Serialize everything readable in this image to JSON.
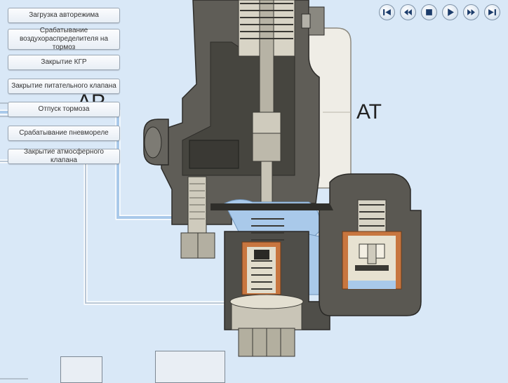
{
  "menu": {
    "items": [
      {
        "label": "Загрузка авторежима"
      },
      {
        "label": "Срабатывание воздухораспределителя на тормоз"
      },
      {
        "label": "Закрытие КГР"
      },
      {
        "label": "Закрытие питательного клапана"
      },
      {
        "label": "Отпуск тормоза"
      },
      {
        "label": "Срабатывание пневмореле"
      },
      {
        "label": "Закрытие атмосферного клапана"
      }
    ]
  },
  "diagram": {
    "label_ar": "АР",
    "label_at": "АТ"
  },
  "controls": {
    "buttons": [
      "skip-to-start-icon",
      "rewind-icon",
      "stop-icon",
      "play-icon",
      "fast-forward-icon",
      "skip-to-end-icon"
    ]
  },
  "colors": {
    "background": "#d9e8f7",
    "air_blue": "#a9c9ea",
    "metal_dark": "#55534d",
    "metal_light": "#b9b6a8",
    "copper": "#c8763f"
  }
}
